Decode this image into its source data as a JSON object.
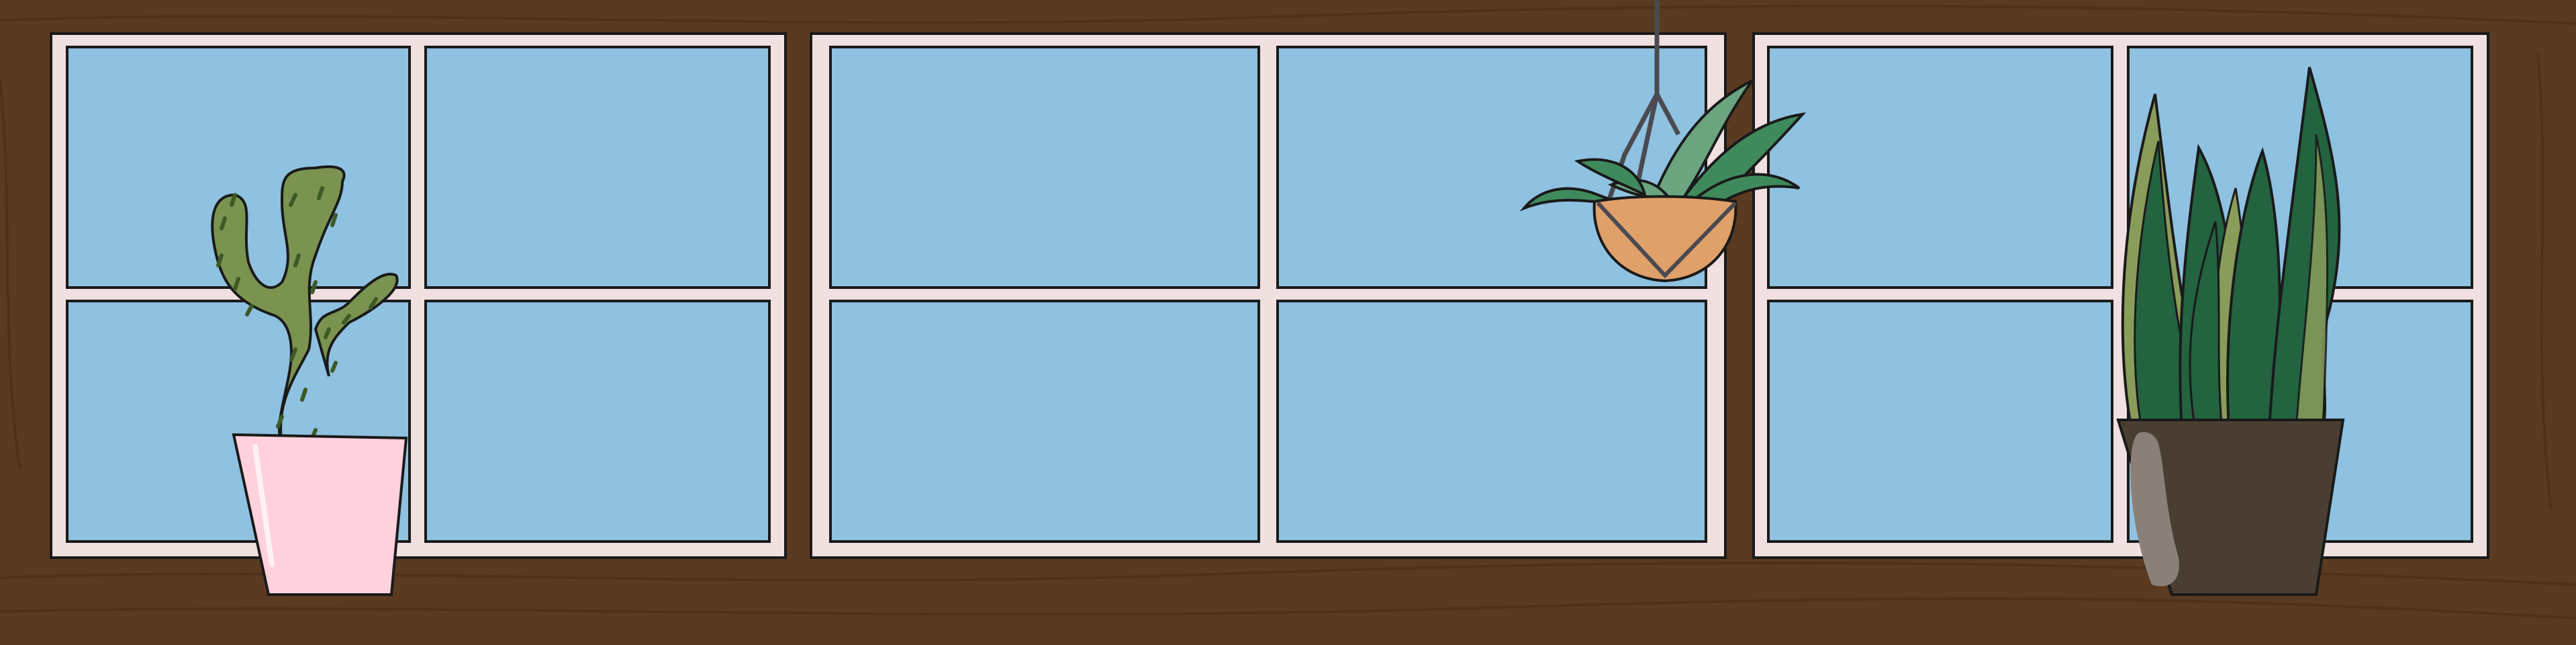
{
  "scene": {
    "description_colors": {
      "wall": "#5a3a20",
      "wall_grain": "#4a2e18",
      "frame": "#f0e0df",
      "outline": "#1a1a1a",
      "glass": "#8fc1e0",
      "cactus": "#7a9450",
      "cactus_spine": "#3d5a25",
      "cactus_pot": "#ffd1dc",
      "hanging_pot": "#e0a06a",
      "hanging_leaf_light": "#6aa57f",
      "hanging_leaf_dark": "#3f8a5c",
      "hanger_rope": "#4a4a50",
      "snake_dark": "#236340",
      "snake_light": "#8a9c5a",
      "snake_pot": "#4a3e33",
      "snake_pot_shine": "#8a8078"
    },
    "icons": [
      "window-icon",
      "cactus-icon",
      "hanging-plant-icon",
      "snake-plant-icon"
    ]
  }
}
